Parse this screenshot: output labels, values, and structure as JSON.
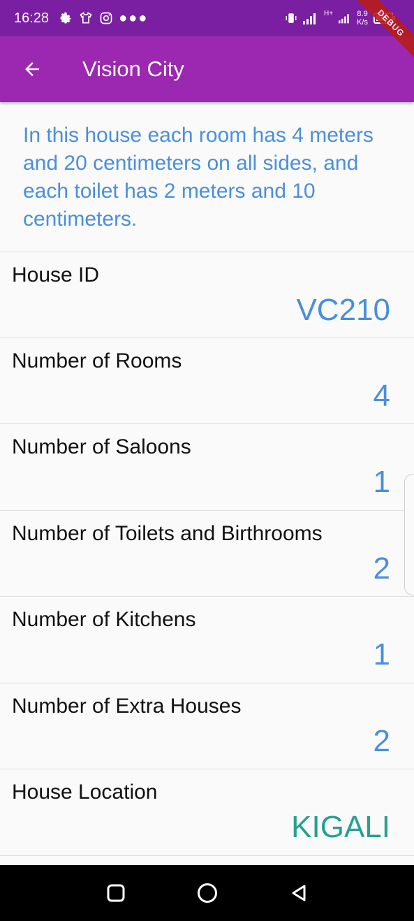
{
  "status_bar": {
    "time": "16:28",
    "speed_value": "8.9",
    "speed_unit": "K/s",
    "network": "H+",
    "debug_banner": "DEBUG"
  },
  "app_bar": {
    "title": "Vision City",
    "back_icon": "arrow-left-icon"
  },
  "details": {
    "description": "In this house each room has 4 meters and 20 centimeters on all sides, and each toilet has 2 meters and 10 centimeters.",
    "rows": [
      {
        "label": "House ID",
        "value": "VC210"
      },
      {
        "label": "Number of Rooms",
        "value": "4"
      },
      {
        "label": "Number of Saloons",
        "value": "1"
      },
      {
        "label": "Number of Toilets and Birthrooms",
        "value": "2"
      },
      {
        "label": "Number of Kitchens",
        "value": "1"
      },
      {
        "label": "Number of Extra Houses",
        "value": "2"
      },
      {
        "label": "House Location",
        "value": "KIGALI"
      }
    ]
  },
  "colors": {
    "status_bar": "#7b1fa2",
    "app_bar": "#9c27b0",
    "value_blue": "#4a8fdc",
    "location_teal": "#26a08f"
  },
  "nav_bar": {
    "icons": [
      "recent-apps-icon",
      "home-icon",
      "back-icon"
    ]
  }
}
